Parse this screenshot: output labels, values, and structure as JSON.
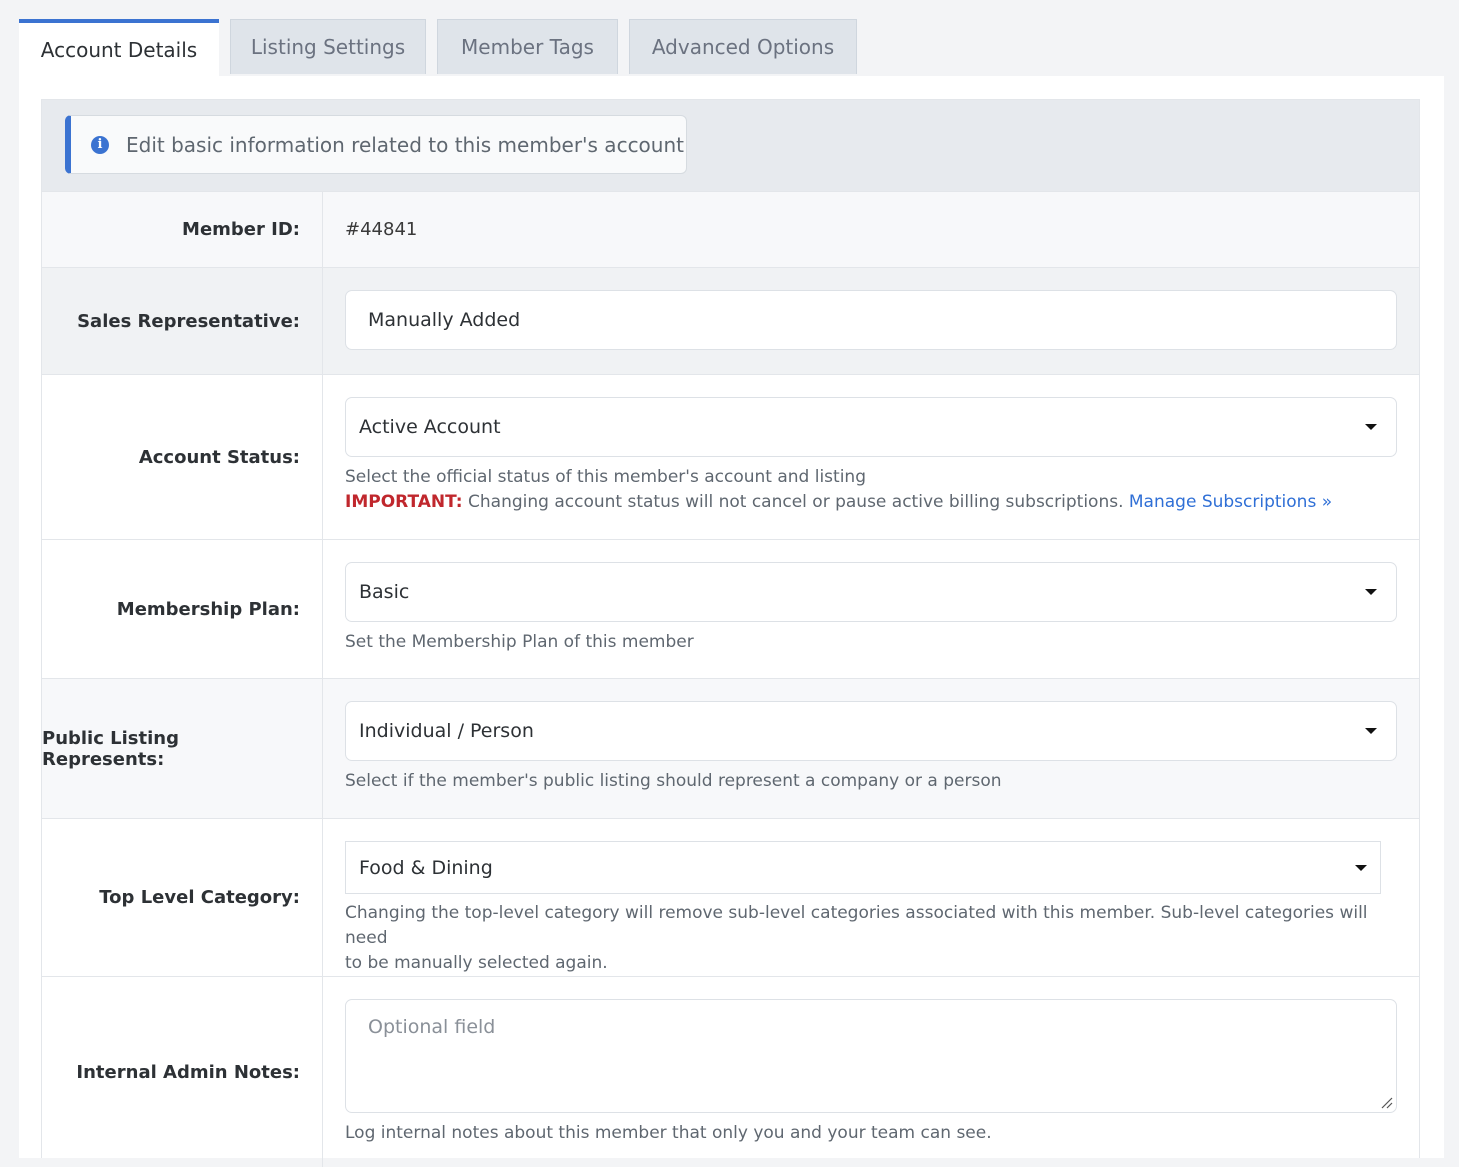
{
  "tabs": [
    {
      "label": "Account Details"
    },
    {
      "label": "Listing Settings"
    },
    {
      "label": "Member Tags"
    },
    {
      "label": "Advanced Options"
    }
  ],
  "banner": {
    "text": "Edit basic information related to this member's account",
    "icon": "info-icon"
  },
  "member_id": {
    "label": "Member ID:",
    "value": "#44841"
  },
  "sales_rep": {
    "label": "Sales Representative:",
    "value": "Manually Added"
  },
  "account_status": {
    "label": "Account Status:",
    "value": "Active Account",
    "help": "Select the official status of this member's account and listing",
    "important_label": "IMPORTANT:",
    "important_text": "Changing account status will not cancel or pause active billing subscriptions.",
    "link": "Manage Subscriptions »"
  },
  "membership_plan": {
    "label": "Membership Plan:",
    "value": "Basic",
    "help": "Set the Membership Plan of this member"
  },
  "listing_represents": {
    "label": "Public Listing Represents:",
    "value": "Individual / Person",
    "help": "Select if the member's public listing should represent a company or a person"
  },
  "top_category": {
    "label": "Top Level Category:",
    "value": "Food & Dining",
    "help_line1": "Changing the top-level category will remove sub-level categories associated with this member. Sub-level categories will need",
    "help_line2": "to be manually selected again."
  },
  "admin_notes": {
    "label": "Internal Admin Notes:",
    "placeholder": "Optional field",
    "help": "Log internal notes about this member that only you and your team can see."
  },
  "colors": {
    "accent": "#3b73d1",
    "important": "#c0272d",
    "link": "#2f6fd6"
  }
}
